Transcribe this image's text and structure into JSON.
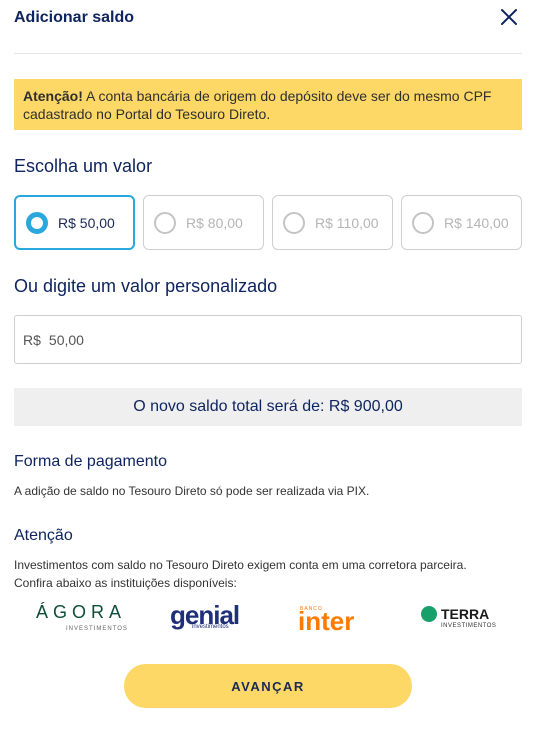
{
  "header": {
    "title": "Adicionar saldo",
    "close_icon": "close-icon"
  },
  "alert": {
    "bold": "Atenção!",
    "text": " A conta bancária de origem do depósito deve ser do mesmo CPF cadastrado no Portal do Tesouro Direto."
  },
  "choose": {
    "heading": "Escolha um valor",
    "options": [
      {
        "label": "R$ 50,00",
        "selected": true
      },
      {
        "label": "R$ 80,00",
        "selected": false
      },
      {
        "label": "R$ 110,00",
        "selected": false
      },
      {
        "label": "R$ 140,00",
        "selected": false
      }
    ]
  },
  "custom": {
    "heading": "Ou digite um valor personalizado",
    "prefix": "R$",
    "value": "50,00"
  },
  "total_text": "O novo saldo total será de: R$ 900,00",
  "payment": {
    "heading": "Forma de pagamento",
    "text": "A adição de saldo no Tesouro Direto só pode ser realizada via PIX."
  },
  "attention": {
    "heading": "Atenção",
    "line1": "Investimentos com saldo no Tesouro Direto exigem conta em uma corretora parceira.",
    "line2": "Confira abaixo as instituições disponíveis:"
  },
  "partners": [
    {
      "name": "ÁGORA",
      "sub": "INVESTIMENTOS"
    },
    {
      "name": "genial",
      "sub": "investimentos"
    },
    {
      "name": "inter",
      "sub": "BANCO"
    },
    {
      "name": "TERRA",
      "sub": "INVESTIMENTOS"
    }
  ],
  "cta": {
    "label": "AVANÇAR"
  },
  "colors": {
    "accent": "#2aa7dc",
    "primary_text": "#0f2560",
    "highlight": "#fdd866"
  }
}
